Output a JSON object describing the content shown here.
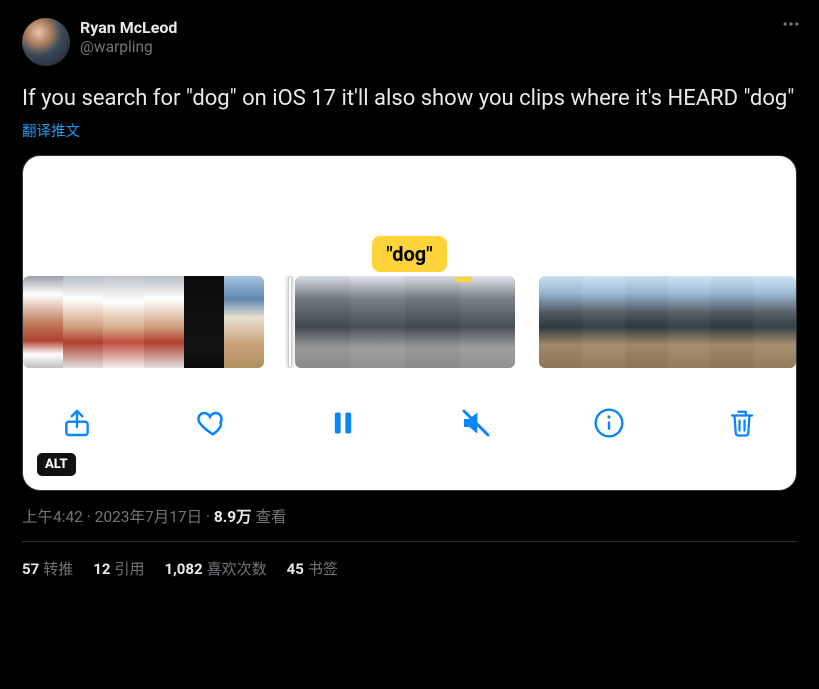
{
  "user": {
    "displayName": "Ryan McLeod",
    "handle": "@warpling"
  },
  "tweet": {
    "text": "If you search for \"dog\" on iOS 17 it'll also show you clips where it's HEARD \"dog\"",
    "translateLabel": "翻译推文"
  },
  "media": {
    "bubbleText": "\"dog\"",
    "altBadge": "ALT"
  },
  "meta": {
    "time": "上午4:42",
    "dot1": " · ",
    "date": "2023年7月17日",
    "dot2": " · ",
    "viewsNumber": "8.9万",
    "viewsLabel": " 查看"
  },
  "stats": {
    "retweets": {
      "count": "57",
      "label": "转推"
    },
    "quotes": {
      "count": "12",
      "label": "引用"
    },
    "likes": {
      "count": "1,082",
      "label": "喜欢次数"
    },
    "bookmarks": {
      "count": "45",
      "label": "书签"
    }
  }
}
